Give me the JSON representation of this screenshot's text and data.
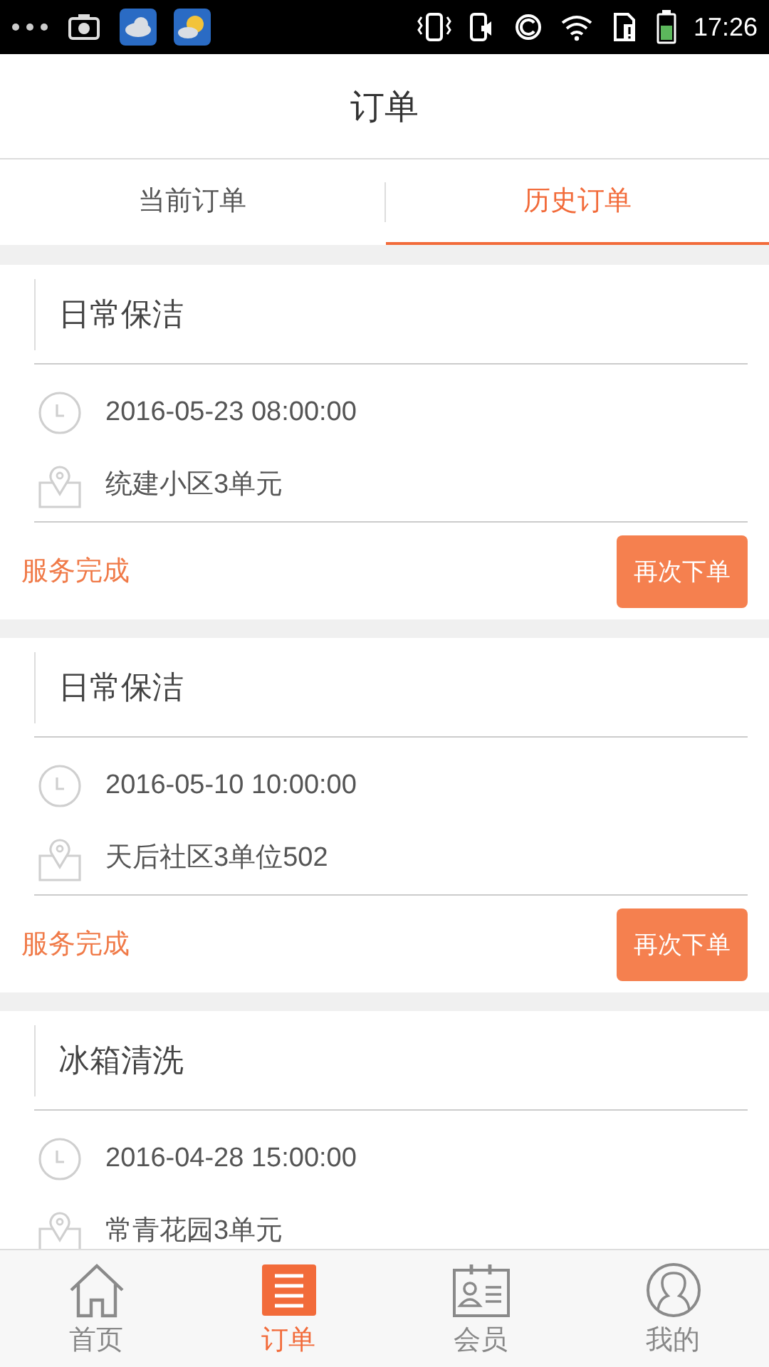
{
  "status_bar": {
    "time": "17:26"
  },
  "header": {
    "title": "订单"
  },
  "tabs": [
    {
      "label": "当前订单",
      "selected": false
    },
    {
      "label": "历史订单",
      "selected": true
    }
  ],
  "orders": [
    {
      "service": "日常保洁",
      "time": "2016-05-23 08:00:00",
      "address": "统建小区3单元",
      "status": "服务完成",
      "action": "再次下单"
    },
    {
      "service": "日常保洁",
      "time": "2016-05-10 10:00:00",
      "address": "天后社区3单位502",
      "status": "服务完成",
      "action": "再次下单"
    },
    {
      "service": "冰箱清洗",
      "time": "2016-04-28 15:00:00",
      "address": "常青花园3单元"
    }
  ],
  "bottom_nav": [
    {
      "kind": "home",
      "label": "首页",
      "selected": false
    },
    {
      "kind": "orders",
      "label": "订单",
      "selected": true
    },
    {
      "kind": "member",
      "label": "会员",
      "selected": false
    },
    {
      "kind": "profile",
      "label": "我的",
      "selected": false
    }
  ]
}
